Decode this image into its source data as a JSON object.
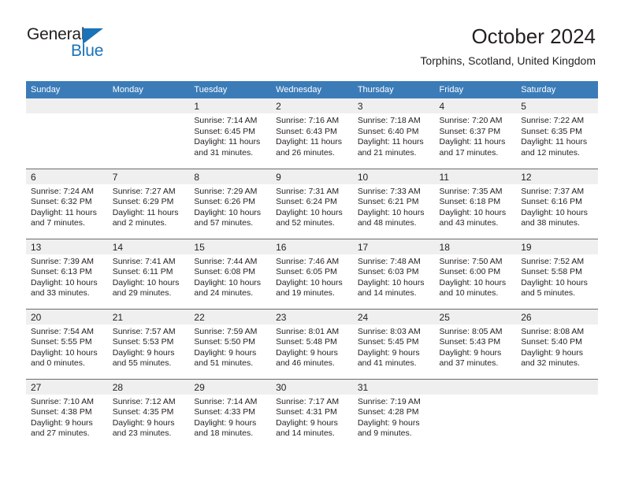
{
  "brand": {
    "name_top": "General",
    "name_bottom": "Blue",
    "triangle_color": "#1a72b8"
  },
  "header": {
    "title": "October 2024",
    "subtitle": "Torphins, Scotland, United Kingdom"
  },
  "theme": {
    "header_bar": "#3b7cb8",
    "daynum_bg": "#efefef",
    "text": "#231f20",
    "rule": "#6b6b6b"
  },
  "weekdays": [
    "Sunday",
    "Monday",
    "Tuesday",
    "Wednesday",
    "Thursday",
    "Friday",
    "Saturday"
  ],
  "weeks": [
    [
      {
        "empty": true
      },
      {
        "empty": true
      },
      {
        "day": "1",
        "sunrise": "Sunrise: 7:14 AM",
        "sunset": "Sunset: 6:45 PM",
        "daylight1": "Daylight: 11 hours",
        "daylight2": "and 31 minutes."
      },
      {
        "day": "2",
        "sunrise": "Sunrise: 7:16 AM",
        "sunset": "Sunset: 6:43 PM",
        "daylight1": "Daylight: 11 hours",
        "daylight2": "and 26 minutes."
      },
      {
        "day": "3",
        "sunrise": "Sunrise: 7:18 AM",
        "sunset": "Sunset: 6:40 PM",
        "daylight1": "Daylight: 11 hours",
        "daylight2": "and 21 minutes."
      },
      {
        "day": "4",
        "sunrise": "Sunrise: 7:20 AM",
        "sunset": "Sunset: 6:37 PM",
        "daylight1": "Daylight: 11 hours",
        "daylight2": "and 17 minutes."
      },
      {
        "day": "5",
        "sunrise": "Sunrise: 7:22 AM",
        "sunset": "Sunset: 6:35 PM",
        "daylight1": "Daylight: 11 hours",
        "daylight2": "and 12 minutes."
      }
    ],
    [
      {
        "day": "6",
        "sunrise": "Sunrise: 7:24 AM",
        "sunset": "Sunset: 6:32 PM",
        "daylight1": "Daylight: 11 hours",
        "daylight2": "and 7 minutes."
      },
      {
        "day": "7",
        "sunrise": "Sunrise: 7:27 AM",
        "sunset": "Sunset: 6:29 PM",
        "daylight1": "Daylight: 11 hours",
        "daylight2": "and 2 minutes."
      },
      {
        "day": "8",
        "sunrise": "Sunrise: 7:29 AM",
        "sunset": "Sunset: 6:26 PM",
        "daylight1": "Daylight: 10 hours",
        "daylight2": "and 57 minutes."
      },
      {
        "day": "9",
        "sunrise": "Sunrise: 7:31 AM",
        "sunset": "Sunset: 6:24 PM",
        "daylight1": "Daylight: 10 hours",
        "daylight2": "and 52 minutes."
      },
      {
        "day": "10",
        "sunrise": "Sunrise: 7:33 AM",
        "sunset": "Sunset: 6:21 PM",
        "daylight1": "Daylight: 10 hours",
        "daylight2": "and 48 minutes."
      },
      {
        "day": "11",
        "sunrise": "Sunrise: 7:35 AM",
        "sunset": "Sunset: 6:18 PM",
        "daylight1": "Daylight: 10 hours",
        "daylight2": "and 43 minutes."
      },
      {
        "day": "12",
        "sunrise": "Sunrise: 7:37 AM",
        "sunset": "Sunset: 6:16 PM",
        "daylight1": "Daylight: 10 hours",
        "daylight2": "and 38 minutes."
      }
    ],
    [
      {
        "day": "13",
        "sunrise": "Sunrise: 7:39 AM",
        "sunset": "Sunset: 6:13 PM",
        "daylight1": "Daylight: 10 hours",
        "daylight2": "and 33 minutes."
      },
      {
        "day": "14",
        "sunrise": "Sunrise: 7:41 AM",
        "sunset": "Sunset: 6:11 PM",
        "daylight1": "Daylight: 10 hours",
        "daylight2": "and 29 minutes."
      },
      {
        "day": "15",
        "sunrise": "Sunrise: 7:44 AM",
        "sunset": "Sunset: 6:08 PM",
        "daylight1": "Daylight: 10 hours",
        "daylight2": "and 24 minutes."
      },
      {
        "day": "16",
        "sunrise": "Sunrise: 7:46 AM",
        "sunset": "Sunset: 6:05 PM",
        "daylight1": "Daylight: 10 hours",
        "daylight2": "and 19 minutes."
      },
      {
        "day": "17",
        "sunrise": "Sunrise: 7:48 AM",
        "sunset": "Sunset: 6:03 PM",
        "daylight1": "Daylight: 10 hours",
        "daylight2": "and 14 minutes."
      },
      {
        "day": "18",
        "sunrise": "Sunrise: 7:50 AM",
        "sunset": "Sunset: 6:00 PM",
        "daylight1": "Daylight: 10 hours",
        "daylight2": "and 10 minutes."
      },
      {
        "day": "19",
        "sunrise": "Sunrise: 7:52 AM",
        "sunset": "Sunset: 5:58 PM",
        "daylight1": "Daylight: 10 hours",
        "daylight2": "and 5 minutes."
      }
    ],
    [
      {
        "day": "20",
        "sunrise": "Sunrise: 7:54 AM",
        "sunset": "Sunset: 5:55 PM",
        "daylight1": "Daylight: 10 hours",
        "daylight2": "and 0 minutes."
      },
      {
        "day": "21",
        "sunrise": "Sunrise: 7:57 AM",
        "sunset": "Sunset: 5:53 PM",
        "daylight1": "Daylight: 9 hours",
        "daylight2": "and 55 minutes."
      },
      {
        "day": "22",
        "sunrise": "Sunrise: 7:59 AM",
        "sunset": "Sunset: 5:50 PM",
        "daylight1": "Daylight: 9 hours",
        "daylight2": "and 51 minutes."
      },
      {
        "day": "23",
        "sunrise": "Sunrise: 8:01 AM",
        "sunset": "Sunset: 5:48 PM",
        "daylight1": "Daylight: 9 hours",
        "daylight2": "and 46 minutes."
      },
      {
        "day": "24",
        "sunrise": "Sunrise: 8:03 AM",
        "sunset": "Sunset: 5:45 PM",
        "daylight1": "Daylight: 9 hours",
        "daylight2": "and 41 minutes."
      },
      {
        "day": "25",
        "sunrise": "Sunrise: 8:05 AM",
        "sunset": "Sunset: 5:43 PM",
        "daylight1": "Daylight: 9 hours",
        "daylight2": "and 37 minutes."
      },
      {
        "day": "26",
        "sunrise": "Sunrise: 8:08 AM",
        "sunset": "Sunset: 5:40 PM",
        "daylight1": "Daylight: 9 hours",
        "daylight2": "and 32 minutes."
      }
    ],
    [
      {
        "day": "27",
        "sunrise": "Sunrise: 7:10 AM",
        "sunset": "Sunset: 4:38 PM",
        "daylight1": "Daylight: 9 hours",
        "daylight2": "and 27 minutes."
      },
      {
        "day": "28",
        "sunrise": "Sunrise: 7:12 AM",
        "sunset": "Sunset: 4:35 PM",
        "daylight1": "Daylight: 9 hours",
        "daylight2": "and 23 minutes."
      },
      {
        "day": "29",
        "sunrise": "Sunrise: 7:14 AM",
        "sunset": "Sunset: 4:33 PM",
        "daylight1": "Daylight: 9 hours",
        "daylight2": "and 18 minutes."
      },
      {
        "day": "30",
        "sunrise": "Sunrise: 7:17 AM",
        "sunset": "Sunset: 4:31 PM",
        "daylight1": "Daylight: 9 hours",
        "daylight2": "and 14 minutes."
      },
      {
        "day": "31",
        "sunrise": "Sunrise: 7:19 AM",
        "sunset": "Sunset: 4:28 PM",
        "daylight1": "Daylight: 9 hours",
        "daylight2": "and 9 minutes."
      },
      {
        "empty": true
      },
      {
        "empty": true
      }
    ]
  ]
}
